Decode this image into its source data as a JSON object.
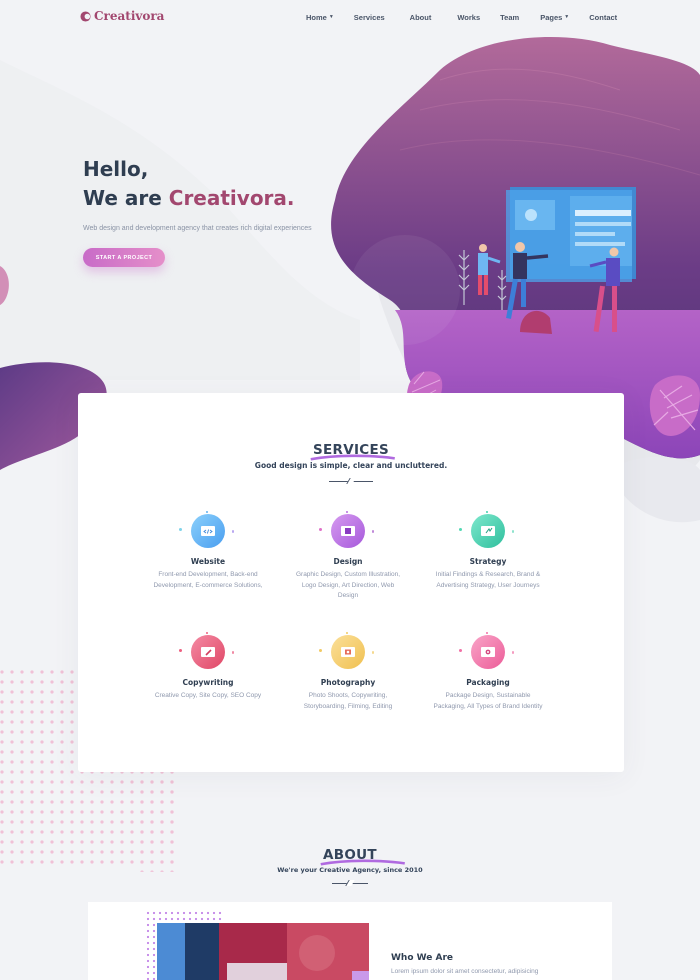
{
  "header": {
    "logo": "Creativora",
    "nav": [
      {
        "label": "Home",
        "dropdown": true
      },
      {
        "label": "Services",
        "dropdown": false
      },
      {
        "label": "About",
        "dropdown": false
      },
      {
        "label": "Works",
        "dropdown": false
      },
      {
        "label": "Team",
        "dropdown": false
      },
      {
        "label": "Pages",
        "dropdown": true
      },
      {
        "label": "Contact",
        "dropdown": false
      }
    ]
  },
  "hero": {
    "greeting": "Hello,",
    "title_prefix": "We are ",
    "brand": "Creativora.",
    "description": "Web design and development agency that creates rich digital experiences",
    "cta": "START A PROJECT"
  },
  "services": {
    "title": "SERVICES",
    "subtitle": "Good design is simple, clear and uncluttered.",
    "items": [
      {
        "title": "Website",
        "icon": "code-window-icon",
        "color": "#5fb0ef",
        "description": "Front-end Development, Back-end Development, E-commerce Solutions,"
      },
      {
        "title": "Design",
        "icon": "design-window-icon",
        "color": "#b66ee0",
        "description": "Graphic Design, Custom Illustration, Logo Design, Art Direction, Web Design"
      },
      {
        "title": "Strategy",
        "icon": "strategy-window-icon",
        "color": "#3fd1ad",
        "description": "Initial Findings & Research, Brand & Advertising Strategy, User Journeys"
      },
      {
        "title": "Copywriting",
        "icon": "pen-window-icon",
        "color": "#ee5f80",
        "description": "Creative Copy, Site Copy, SEO Copy"
      },
      {
        "title": "Photography",
        "icon": "photo-window-icon",
        "color": "#f2ca64",
        "description": "Photo Shoots, Copywriting, Storyboarding, Filming, Editing"
      },
      {
        "title": "Packaging",
        "icon": "package-window-icon",
        "color": "#f270a6",
        "description": "Package Design, Sustainable Packaging, All Types of Brand Identity"
      }
    ]
  },
  "about": {
    "title": "ABOUT",
    "subtitle": "We're your Creative Agency, since 2010",
    "heading": "Who We Are",
    "text": "Lorem ipsum dolor sit amet consectetur, adipisicing"
  },
  "colors": {
    "brand": "#a2476f",
    "heading": "#2f3e51",
    "accent_purple": "#8d4fc1",
    "background": "#f2f3f6"
  }
}
